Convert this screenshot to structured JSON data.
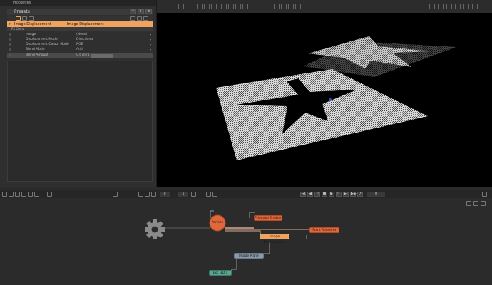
{
  "properties_panel": {
    "title": "Properties",
    "presets_label": "Presets",
    "header_name": "Image Displacement",
    "header_type": "Image Displacement",
    "effect_row_label": "FX Ctrlrs",
    "params": [
      {
        "name": "Image",
        "value": "(None)"
      },
      {
        "name": "Displacement Mode",
        "value": "Directional"
      },
      {
        "name": "Displacement Colour Mode",
        "value": "RGB"
      },
      {
        "name": "Blend Mode",
        "value": "Add"
      },
      {
        "name": "Blend Amount",
        "value": "0.67671"
      }
    ]
  },
  "timeline": {
    "frame_value": "0",
    "end_value": "1",
    "counter": "0"
  },
  "nodes": {
    "particle": "Particle",
    "primitive_emitter": "Primitive Emitter",
    "image_displacement": "Image Displacement",
    "point_renderer": "Point Renderer",
    "image_plane": "Image Plane",
    "sub_node": "Ext. 3D.1"
  },
  "colors": {
    "accent_orange": "#f0a35e",
    "node_orange": "#e0673a",
    "node_blue": "#8c9aad",
    "node_teal": "#5aa593",
    "viewport_bg": "#000000"
  },
  "icons": {
    "graph_gear": "gear-icon"
  }
}
